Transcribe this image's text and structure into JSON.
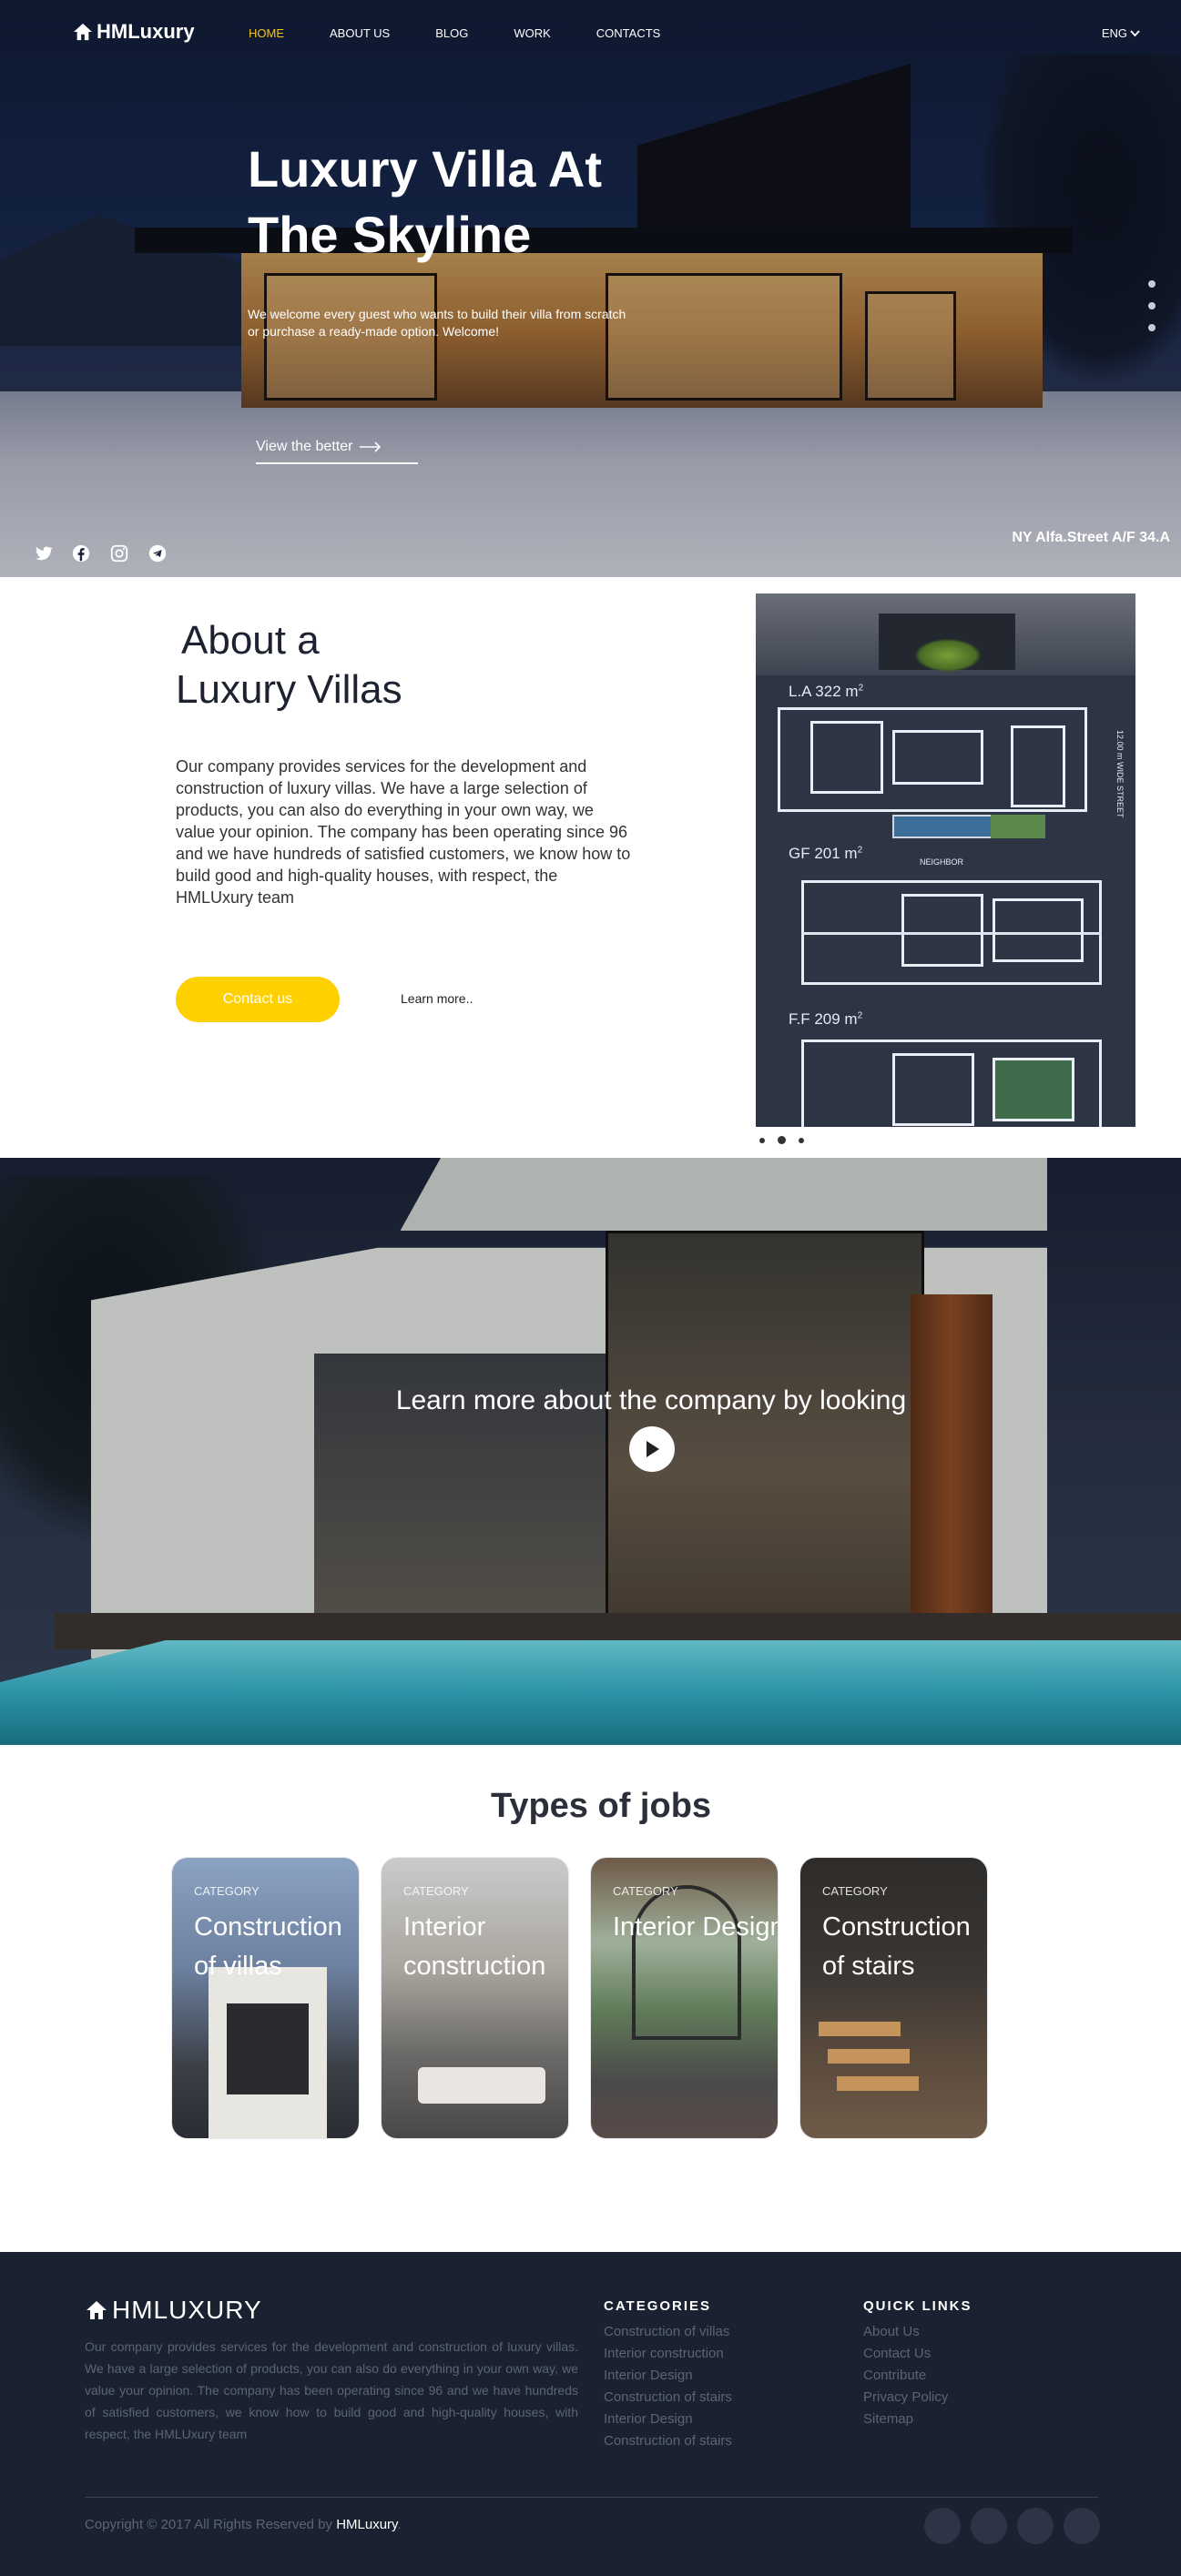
{
  "brand": {
    "name": "HMLuxury",
    "footer_name": "HMLUXURY"
  },
  "nav": {
    "items": [
      {
        "label": "HOME",
        "active": true
      },
      {
        "label": "ABOUT US",
        "active": false
      },
      {
        "label": "BLOG",
        "active": false
      },
      {
        "label": "WORK",
        "active": false
      },
      {
        "label": "CONTACTS",
        "active": false
      }
    ],
    "language": "ENG"
  },
  "hero": {
    "title_line1": "Luxury Villa At",
    "title_line2": "The Skyline",
    "subtitle_line1": "We welcome every guest who wants to build their villa from scratch",
    "subtitle_line2": "or purchase a ready-made option. Welcome!",
    "cta": "View the better",
    "address": "NY Alfa.Street A/F 34.A",
    "slide_count": 3,
    "socials": [
      "twitter-icon",
      "facebook-icon",
      "instagram-icon",
      "telegram-icon"
    ]
  },
  "about": {
    "title_line1": "About a",
    "title_line2": "Luxury Villas",
    "text": "Our company provides services for the development and construction of luxury villas. We have a large selection of products, you can also do everything in your own way, we value your opinion. The company has been operating since 96 and we have hundreds of satisfied customers, we know how to build good and high-quality houses, with respect, the HMLUxury team",
    "contact_button": "Contact us",
    "learn_more": "Learn more..",
    "plan_labels": {
      "la": "L.A 322 m",
      "gf": "GF 201 m",
      "ff": "F.F 209 m",
      "sup": "2",
      "neighbor": "NEIGHBOR",
      "street": "12.00 m WIDE STREET"
    }
  },
  "video": {
    "title": "Learn more about the company by looking"
  },
  "jobs": {
    "title": "Types of jobs",
    "cards": [
      {
        "category": "CATEGORY",
        "name": "Construction of villas"
      },
      {
        "category": "CATEGORY",
        "name": "Interior construction"
      },
      {
        "category": "CATEGORY",
        "name": "Interior Design"
      },
      {
        "category": "CATEGORY",
        "name": "Construction of stairs"
      }
    ]
  },
  "footer": {
    "text": "Our company provides services for the development and construction of luxury villas. We have a large selection of products, you can also do everything in your own way, we value your opinion. The company has been operating since 96 and we have hundreds of satisfied customers, we know how to build good and high-quality houses, with respect, the HMLUxury team",
    "categories_title": "CATEGORIES",
    "categories": [
      "Construction of villas",
      "Interior construction",
      "Interior Design",
      "Construction of stairs",
      "Interior Design",
      "Construction of stairs"
    ],
    "links_title": "QUICK LINKS",
    "links": [
      "About Us",
      "Contact Us",
      "Contribute",
      "Privacy Policy",
      "Sitemap"
    ],
    "copyright": "Copyright © 2017 All Rights Reserved by",
    "copyright_brand": "HMLuxury",
    "copyright_end": "."
  },
  "colors": {
    "accent": "#ffd000",
    "active_nav": "#f5c518",
    "footer_bg": "#1a2231"
  }
}
